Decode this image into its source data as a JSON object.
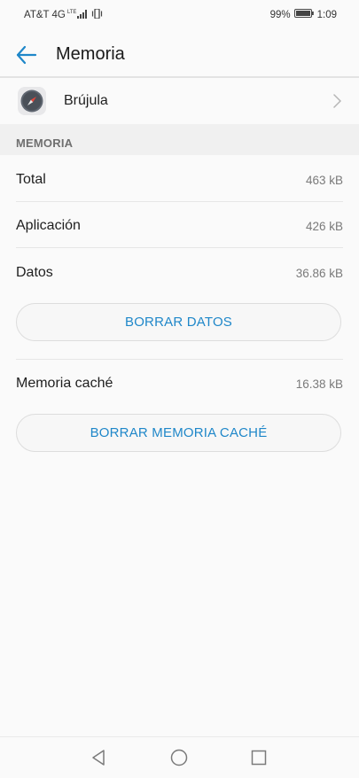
{
  "status_bar": {
    "carrier": "AT&T 4G",
    "network_tag": "LTE",
    "battery": "99%",
    "time": "1:09",
    "icons": [
      "signal-icon",
      "vibrate-icon",
      "battery-icon"
    ]
  },
  "header": {
    "title": "Memoria",
    "back_icon": "arrow-left-icon"
  },
  "app": {
    "name": "Brújula",
    "icon": "compass-icon"
  },
  "section": {
    "title": "MEMORIA"
  },
  "rows": [
    {
      "label": "Total",
      "value": "463 kB"
    },
    {
      "label": "Aplicación",
      "value": "426 kB"
    },
    {
      "label": "Datos",
      "value": "36.86 kB"
    }
  ],
  "clear_data_button": "BORRAR DATOS",
  "cache": {
    "label": "Memoria caché",
    "value": "16.38 kB"
  },
  "clear_cache_button": "BORRAR MEMORIA CACHÉ",
  "nav_bar": {
    "icons": [
      "nav-back-icon",
      "nav-home-icon",
      "nav-recents-icon"
    ]
  },
  "colors": {
    "accent": "#1f87c9",
    "background": "#fafafa",
    "section_bg": "#f0f0f0"
  }
}
